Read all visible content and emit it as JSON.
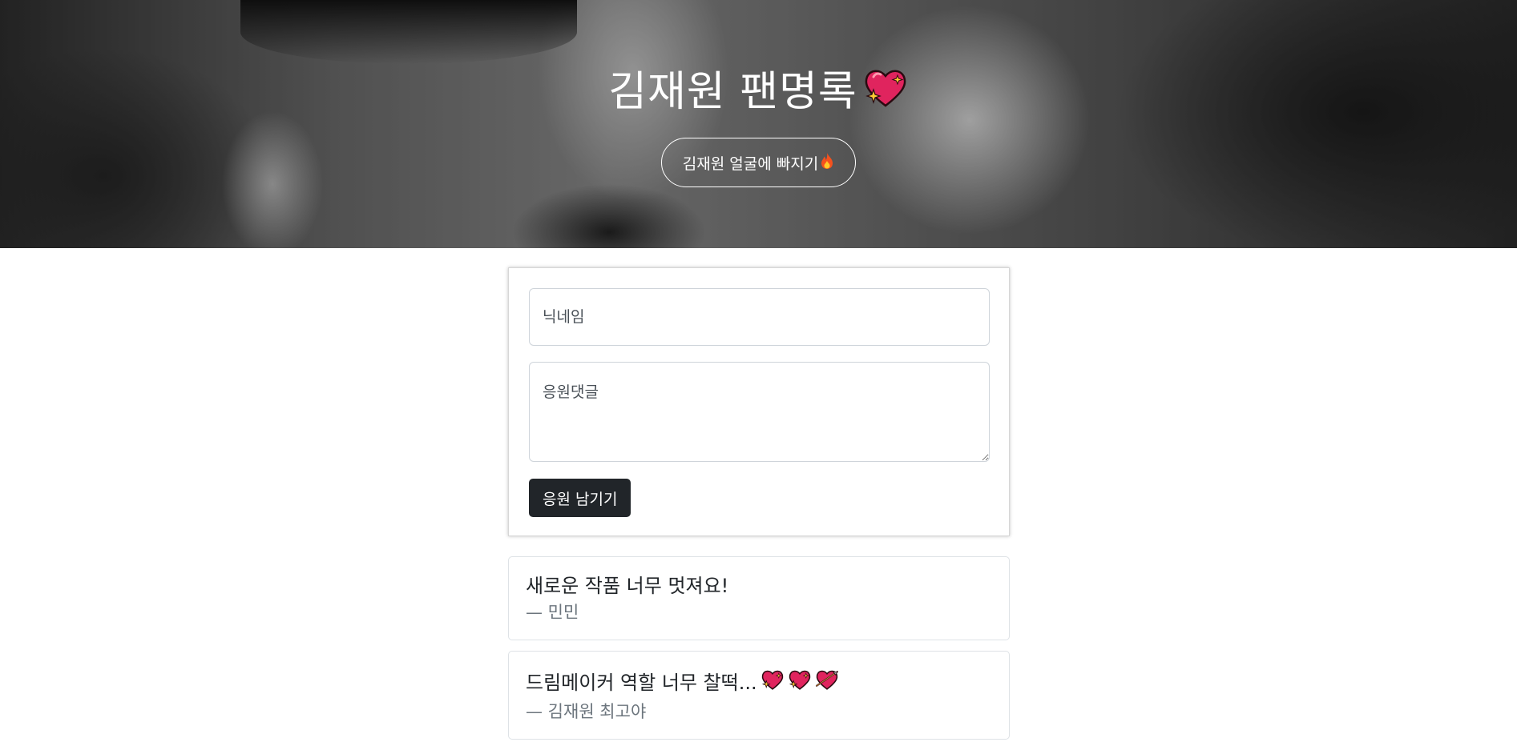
{
  "hero": {
    "title": "김재원 팬명록",
    "button_label": "김재원 얼굴에 빠지기"
  },
  "form": {
    "nickname_placeholder": "닉네임",
    "comment_placeholder": "응원댓글",
    "submit_label": "응원 남기기"
  },
  "comments": [
    {
      "text": "새로운 작품 너무 멋져요!",
      "author": "— 민민"
    },
    {
      "text": "드림메이커 역할 너무 찰떡...",
      "author": "— 김재원 최고야"
    }
  ],
  "colors": {
    "dark_button": "#212529",
    "muted_text": "#6c757d",
    "heart_red": "#e0245e",
    "sparkle_yellow": "#ffcc33"
  },
  "icons": {
    "title_icon": "sparkling-heart-icon",
    "button_icon": "flame-icon",
    "comment_icons": [
      "sparkling-heart-icon",
      "sparkling-heart-icon",
      "heart-with-arrow-icon"
    ]
  }
}
